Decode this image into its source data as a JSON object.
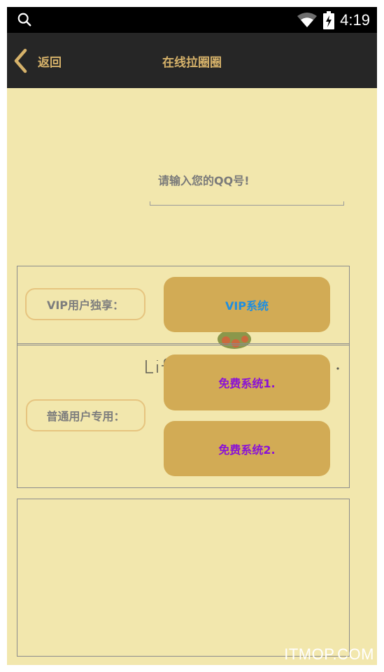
{
  "status_bar": {
    "time": "4:19",
    "icons": [
      "search-icon",
      "wifi-icon",
      "battery-charging-icon"
    ]
  },
  "app_bar": {
    "back_label": "返回",
    "title": "在线拉圈圈"
  },
  "qq_input": {
    "placeholder": "请输入您的QQ号!",
    "value": ""
  },
  "vip_section": {
    "label": "VIP用户独享：",
    "button_label": "VIP系统"
  },
  "free_section": {
    "label": "普通用户专用：",
    "button1_label": "免费系统1.",
    "button2_label": "免费系统2."
  },
  "colors": {
    "page_background": "#f2e7ad",
    "app_bar": "#262626",
    "accent_gold": "#d6b26a",
    "button_fill": "#d2ab55",
    "vip_text": "#1f8ee0",
    "free_text": "#8a12d6"
  },
  "watermark": "ITMOP.COM"
}
